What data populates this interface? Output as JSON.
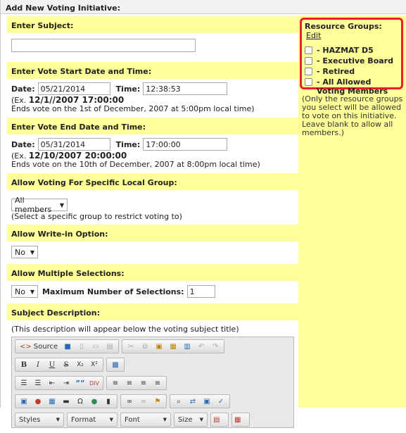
{
  "page": {
    "title": "Add New Voting Initiative:"
  },
  "subject": {
    "heading": "Enter Subject:",
    "value": ""
  },
  "start": {
    "heading": "Enter Vote Start Date and Time:",
    "date_label": "Date:",
    "date_value": "05/21/2014",
    "time_label": "Time:",
    "time_value": "12:38:53",
    "example_prefix": "(Ex. ",
    "example_value": "12/1//2007 17:00:00",
    "example_note": "Ends vote on the 1st of December, 2007 at 5:00pm local time)"
  },
  "end": {
    "heading": "Enter Vote End Date and Time:",
    "date_label": "Date:",
    "date_value": "05/31/2014",
    "time_label": "Time:",
    "time_value": "17:00:00",
    "example_prefix": "(Ex. ",
    "example_value": "12/10/2007 20:00:00",
    "example_note": "Ends vote on the 10th of December, 2007 at 8:00pm local time)"
  },
  "local_group": {
    "heading": "Allow Voting For Specific Local Group:",
    "selected": "All members",
    "note": "(Select a specific group to restrict voting to)"
  },
  "write_in": {
    "heading": "Allow Write-in Option:",
    "selected": "No"
  },
  "multiple": {
    "heading": "Allow Multiple Selections:",
    "selected": "No",
    "max_label": "Maximum Number of Selections:",
    "max_value": "1"
  },
  "description": {
    "heading": "Subject Description:",
    "note": "(This description will appear below the voting subject title)"
  },
  "editor": {
    "source_label": "Source",
    "bold": "B",
    "italic": "I",
    "underline": "U",
    "strike": "S",
    "subscript": "X₂",
    "superscript": "X²",
    "blockquote": "””",
    "styles": "Styles",
    "format": "Format",
    "font": "Font",
    "size": "Size"
  },
  "resource_groups": {
    "title": "Resource Groups:",
    "edit_link": "Edit",
    "items": [
      "- HAZMAT D5",
      "- Executive Board",
      "- Retired",
      "- All Allowed Voting Members"
    ],
    "note": "(Only the resource groups you select will be allowed to vote on this initiative. Leave blank to allow all members.)"
  },
  "colors": {
    "accent_yellow": "#ffff99",
    "highlight_red": "#e8202a"
  }
}
